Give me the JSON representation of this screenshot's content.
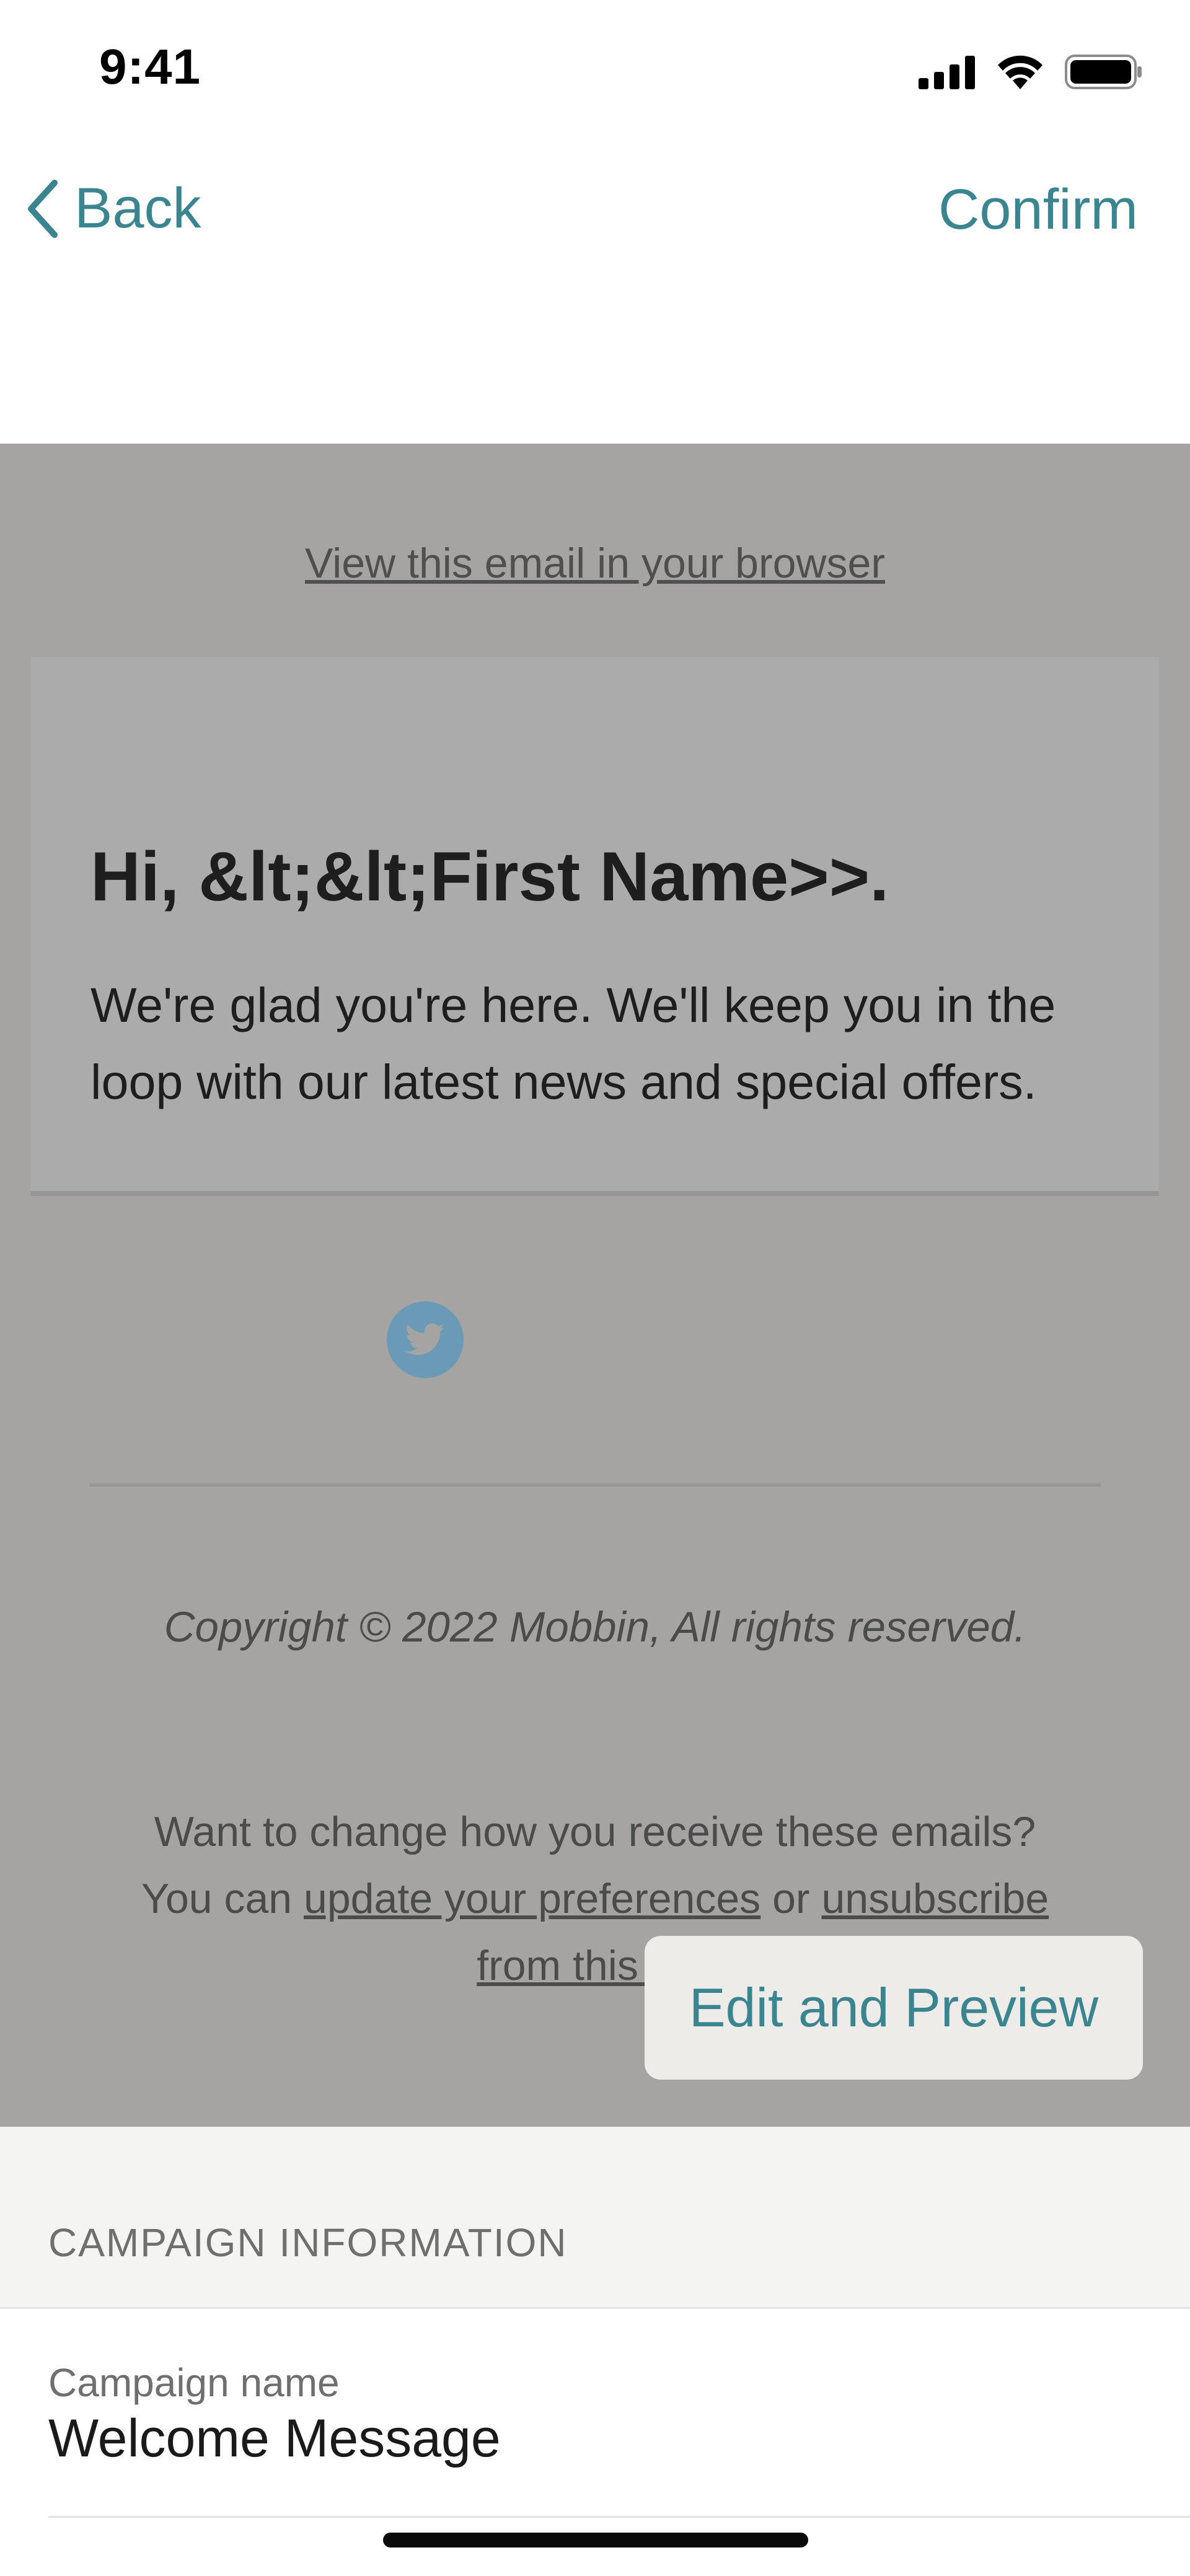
{
  "status_bar": {
    "time": "9:41"
  },
  "nav": {
    "back_label": "Back",
    "confirm_label": "Confirm"
  },
  "email_preview": {
    "view_in_browser": "View this email in your browser",
    "greeting": "Hi, &lt;&lt;First Name>>.",
    "body": "We're glad you're here. We'll keep you in the loop with our latest news and special offers.",
    "social_icon": "twitter-icon",
    "copyright": "Copyright © 2022 Mobbin, All rights reserved.",
    "prefs_line1": "Want to change how you receive these emails?",
    "prefs_you_can": "You can",
    "prefs_update_link": "update your preferences",
    "prefs_or": "or",
    "prefs_unsubscribe_link": "unsubscribe",
    "prefs_from_this": "from this list."
  },
  "edit_preview_button": "Edit and Preview",
  "campaign_info": {
    "section_title": "CAMPAIGN INFORMATION",
    "campaign_name_label": "Campaign name",
    "campaign_name_value": "Welcome Message"
  },
  "colors": {
    "accent": "#3a8590",
    "overlay_bg": "#a5a4a3",
    "section_bg": "#f4f4f2"
  }
}
